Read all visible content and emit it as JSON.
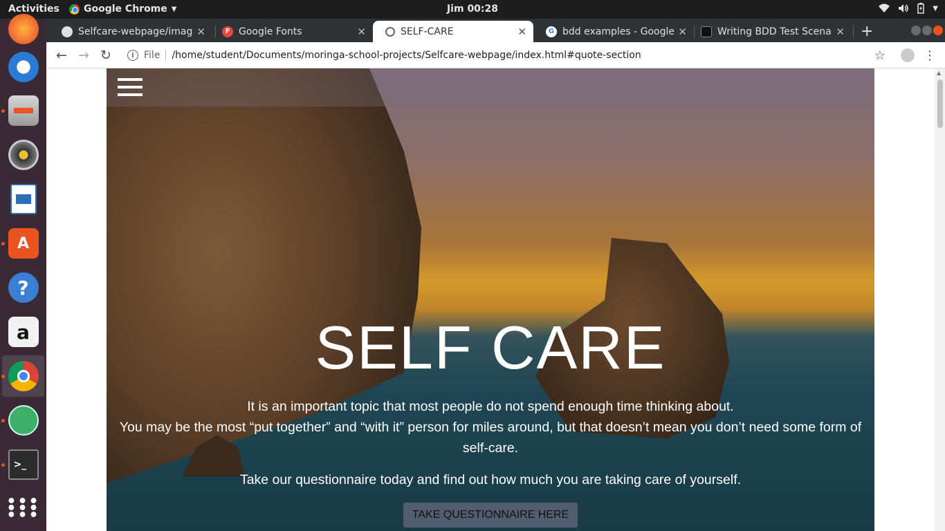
{
  "topbar": {
    "activities": "Activities",
    "app_name": "Google Chrome",
    "clock": "Jim 00:28"
  },
  "dock": {
    "items": [
      "firefox",
      "thunderbird",
      "files",
      "rhythmbox",
      "libreoffice-writer",
      "software",
      "help",
      "amazon",
      "chrome",
      "atom",
      "terminal",
      "show-apps"
    ]
  },
  "tabs": [
    {
      "title": "Selfcare-webpage/image",
      "favicon": "github-icon"
    },
    {
      "title": "Google Fonts",
      "favicon": "google-fonts-icon"
    },
    {
      "title": "SELF-CARE",
      "favicon": "globe-icon",
      "active": true
    },
    {
      "title": "bdd examples - Google S",
      "favicon": "google-icon"
    },
    {
      "title": "Writing BDD Test Scenar",
      "favicon": "site-icon"
    }
  ],
  "toolbar": {
    "scheme_label": "File",
    "url": "/home/student/Documents/moringa-school-projects/Selfcare-webpage/index.html#quote-section"
  },
  "page": {
    "title": "SELF CARE",
    "line1": "It is an important topic that most people do not spend enough time thinking about.",
    "line2": "You may be the most “put together” and “with it” person for miles around, but that doesn’t mean you don’t need some form of self-care.",
    "line3": "Take our questionnaire today and find out how much you are taking care of yourself.",
    "cta_label": "TAKE QUESTIONNAIRE HERE"
  },
  "colors": {
    "dock_bg": "#3a2a35",
    "tabstrip_bg": "#2f3336",
    "accent_dot": "#e95420"
  }
}
